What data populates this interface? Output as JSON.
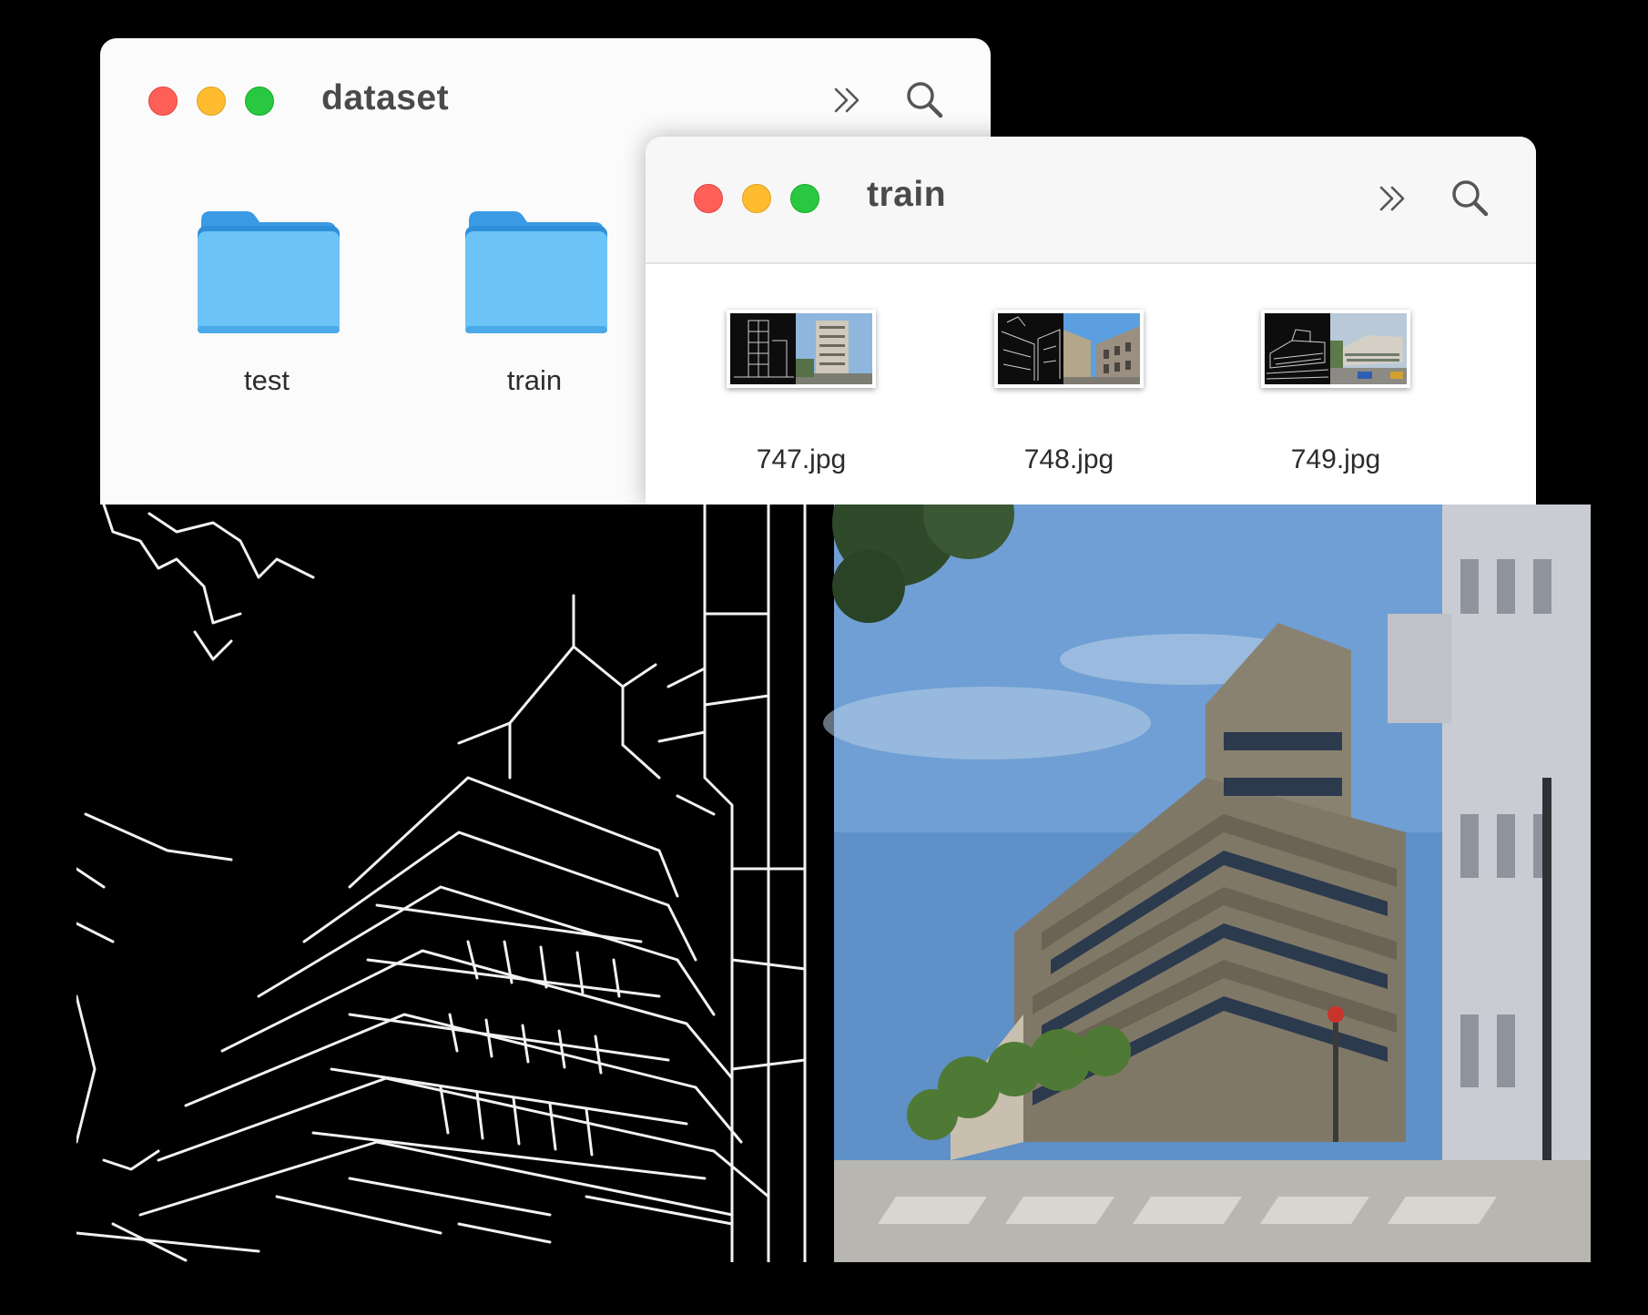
{
  "windows": {
    "dataset": {
      "title": "dataset",
      "folders": [
        {
          "label": "test"
        },
        {
          "label": "train"
        }
      ]
    },
    "train": {
      "title": "train",
      "files": [
        {
          "label": "747.jpg"
        },
        {
          "label": "748.jpg"
        },
        {
          "label": "749.jpg"
        }
      ]
    }
  },
  "icons": {
    "traffic_lights": [
      "close",
      "minimize",
      "zoom"
    ],
    "toolbar": [
      "chevrons-more-icon",
      "search-icon"
    ],
    "folder": "folder-icon"
  },
  "colors": {
    "close": "#ff5f57",
    "minimize": "#febc2e",
    "zoom": "#28c840",
    "folder_blue": "#6cc3f7"
  }
}
